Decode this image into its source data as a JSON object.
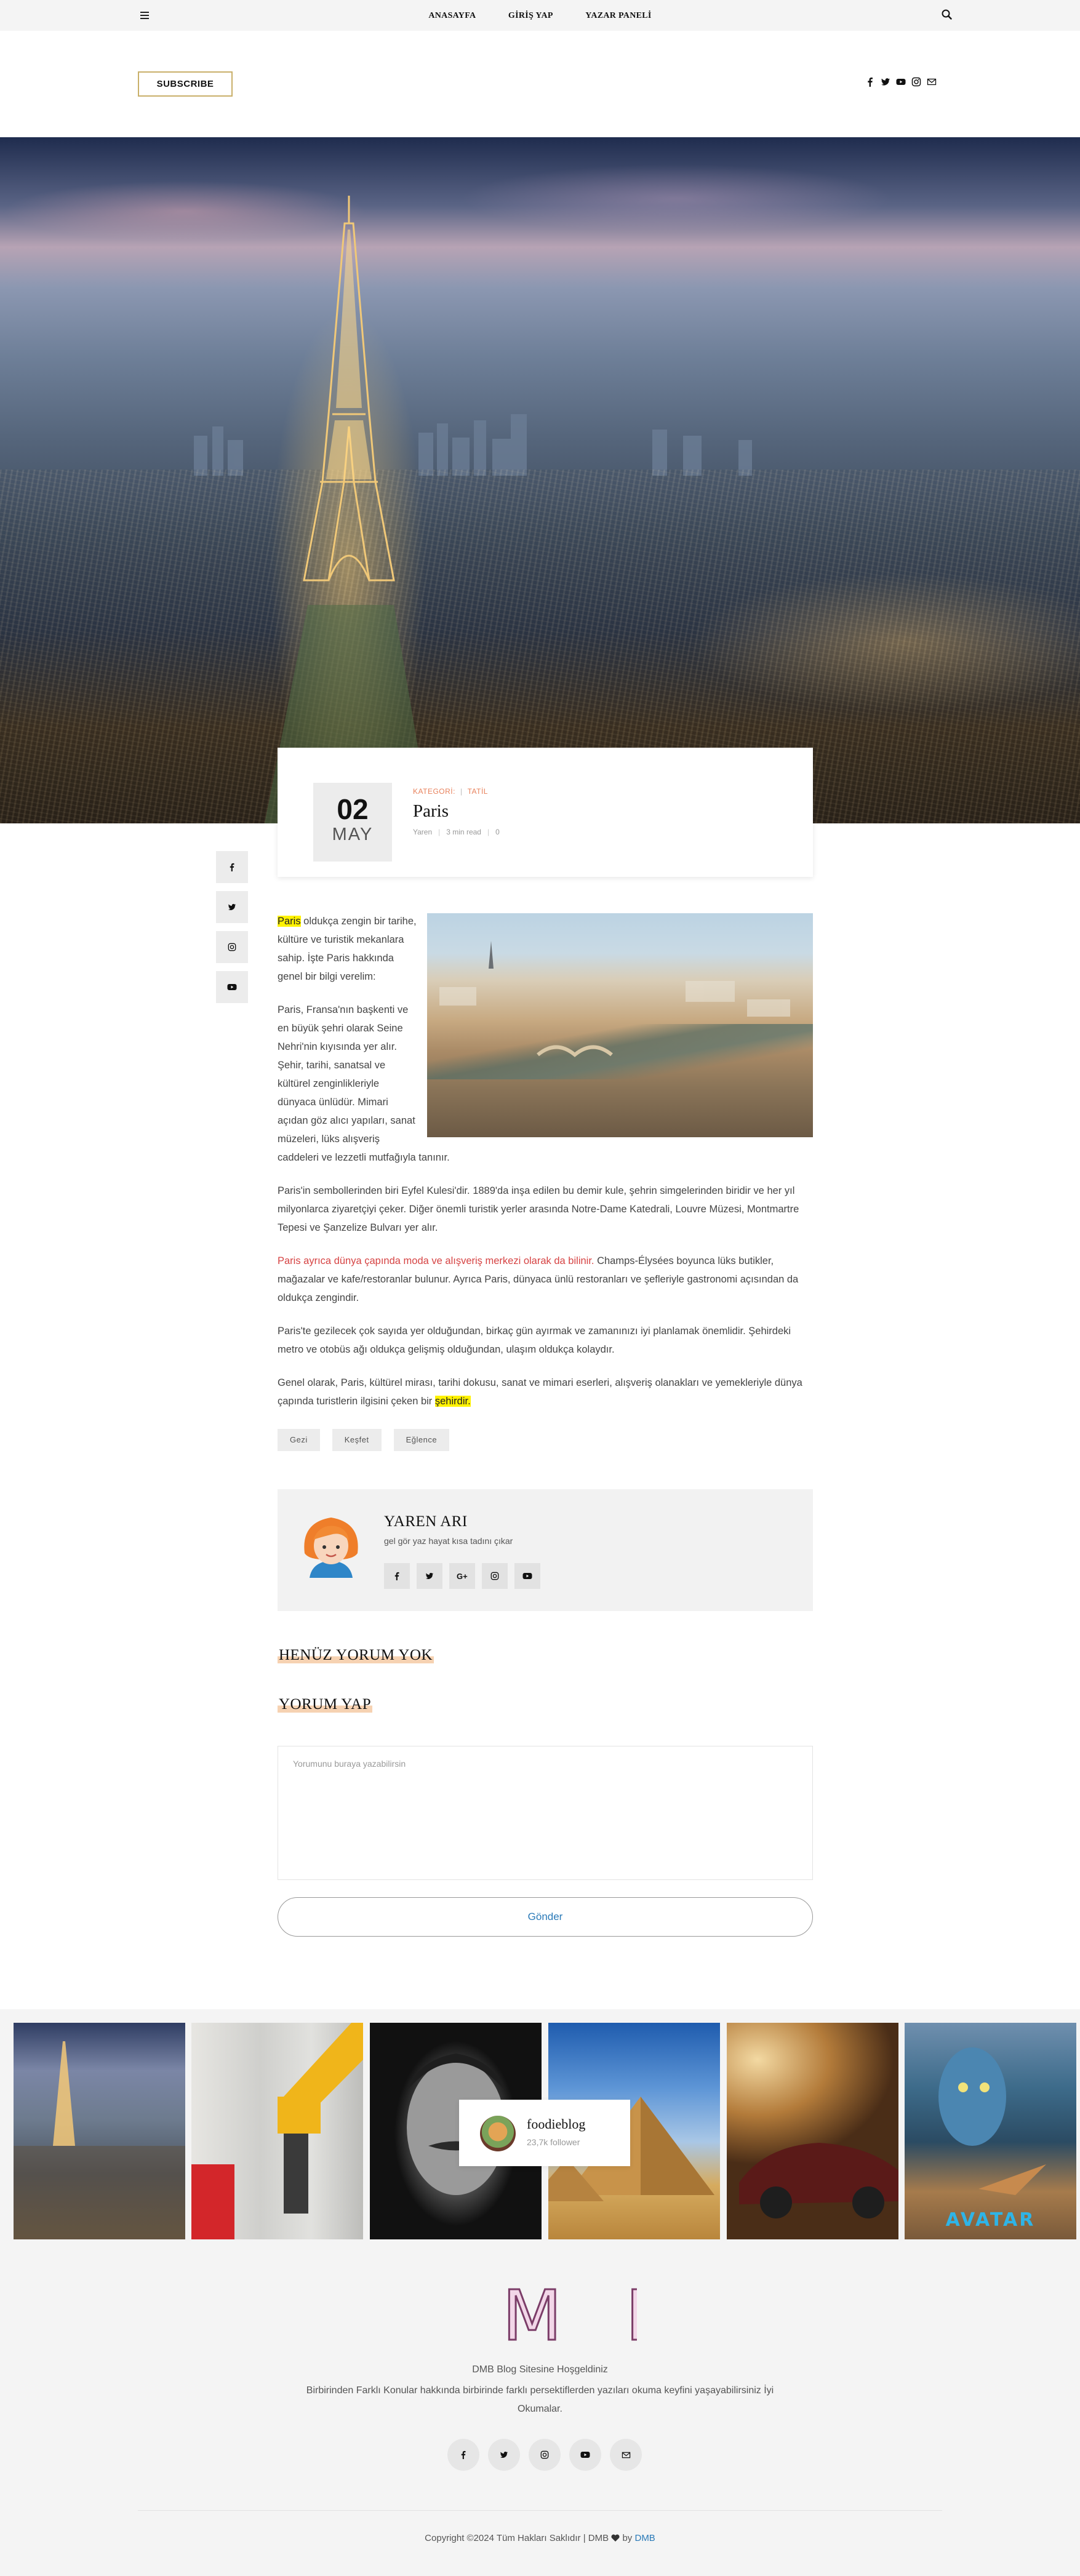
{
  "nav": {
    "links": [
      "ANASAYFA",
      "GİRİŞ YAP",
      "YAZAR PANELİ"
    ],
    "menu_icon": "hamburger-icon",
    "search_icon": "search-icon"
  },
  "header": {
    "subscribe_label": "SUBSCRIBE",
    "social_icons": [
      "facebook-icon",
      "twitter-icon",
      "youtube-icon",
      "instagram-icon",
      "mail-icon"
    ]
  },
  "post": {
    "day": "02",
    "month": "MAY",
    "category_label": "KATEGORİ:",
    "category": "TATİL",
    "title": "Paris",
    "author": "Yaren",
    "read_time": "3 min read",
    "comments": "0"
  },
  "share_icons": [
    "facebook-icon",
    "twitter-icon",
    "instagram-icon",
    "youtube-icon"
  ],
  "article": {
    "p1_highlight": "Paris",
    "p1_rest": " oldukça zengin bir tarihe, kültüre ve turistik mekanlara sahip. İşte Paris hakkında genel bir bilgi verelim:",
    "p2": "Paris, Fransa'nın başkenti ve en büyük şehri olarak Seine Nehri'nin kıyısında yer alır. Şehir, tarihi, sanatsal ve kültürel zenginlikleriyle dünyaca ünlüdür. Mimari açıdan göz alıcı yapıları, sanat müzeleri, lüks alışveriş caddeleri ve lezzetli mutfağıyla tanınır.",
    "p3": "Paris'in sembollerinden biri Eyfel Kulesi'dir. 1889'da inşa edilen bu demir kule, şehrin simgelerinden biridir ve her yıl milyonlarca ziyaretçiyi çeker. Diğer önemli turistik yerler arasında Notre-Dame Katedrali, Louvre Müzesi, Montmartre Tepesi ve Şanzelize Bulvarı yer alır.",
    "p4_red": "Paris ayrıca dünya çapında moda ve alışveriş merkezi olarak da bilinir.",
    "p4_rest": " Champs-Élysées boyunca lüks butikler, mağazalar ve kafe/restoranlar bulunur. Ayrıca Paris, dünyaca ünlü restoranları ve şefleriyle gastronomi açısından da oldukça zengindir.",
    "p5": "Paris'te gezilecek çok sayıda yer olduğundan, birkaç gün ayırmak ve zamanınızı iyi planlamak önemlidir. Şehirdeki metro ve otobüs ağı oldukça gelişmiş olduğundan, ulaşım oldukça kolaydır.",
    "p6_start": "Genel olarak, Paris, kültürel mirası, tarihi dokusu, sanat ve mimari eserleri, alışveriş olanakları ve yemekleriyle dünya çapında turistlerin ilgisini çeken bir ",
    "p6_highlight": "şehirdir."
  },
  "tags": [
    "Gezi",
    "Keşfet",
    "Eğlence"
  ],
  "author_box": {
    "name": "YAREN ARI",
    "bio": "gel gör yaz hayat kısa tadını çıkar",
    "social_icons": [
      "facebook-icon",
      "twitter-icon",
      "google-plus-icon",
      "instagram-icon",
      "youtube-icon"
    ]
  },
  "comments": {
    "no_comments": "HENÜZ YORUM YOK",
    "write_title": "YORUM YAP",
    "placeholder": "Yorumunu buraya yazabilirsin",
    "submit_label": "Gönder"
  },
  "instagram": {
    "username": "foodieblog",
    "followers": "23,7k follower",
    "avatar_caption": "AVATAR"
  },
  "footer": {
    "logo_text": "D M B",
    "welcome": "DMB Blog Sitesine Hoşgeldiniz",
    "description": "Birbirinden Farklı Konular hakkında birbirinde farklı persektiflerden yazıları okuma keyfini yaşayabilirsiniz İyi Okumalar.",
    "social_icons": [
      "facebook-icon",
      "twitter-icon",
      "instagram-icon",
      "youtube-icon",
      "mail-icon"
    ],
    "copyright_prefix": "Copyright ©2024 Tüm Hakları Saklıdır | DMB",
    "copyright_by": "by",
    "copyright_link": "DMB"
  }
}
